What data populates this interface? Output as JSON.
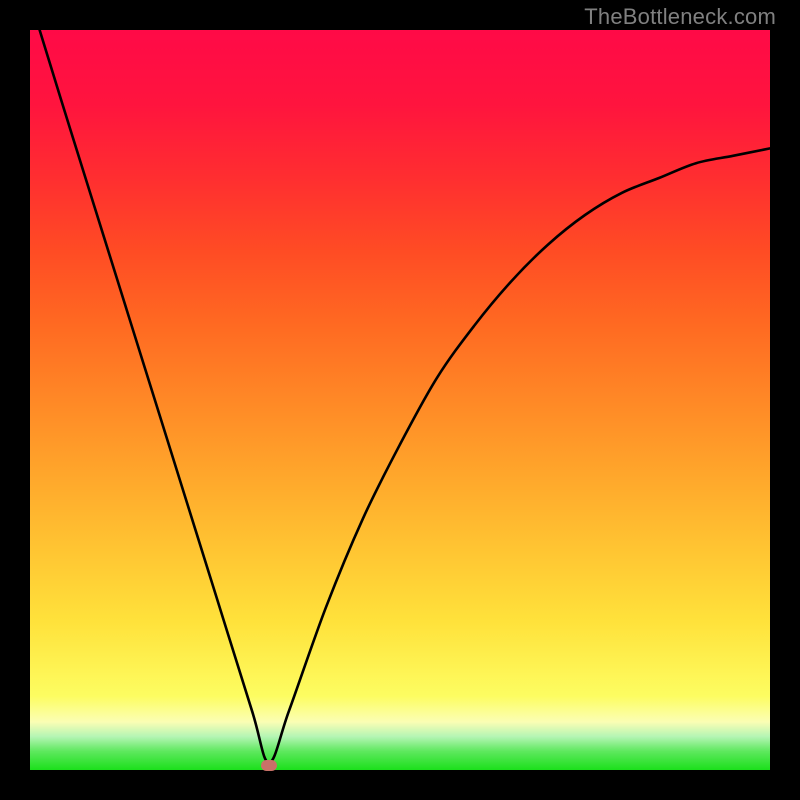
{
  "watermark": "TheBottleneck.com",
  "colors": {
    "watermark": "#808080",
    "marker": "#c97168",
    "curve": "#000000",
    "frame": "#000000"
  },
  "chart_data": {
    "type": "line",
    "title": "",
    "xlabel": "",
    "ylabel": "",
    "xlim": [
      0,
      1
    ],
    "ylim": [
      0,
      1
    ],
    "legend": false,
    "grid": false,
    "series": [
      {
        "name": "bottleneck-curve",
        "x": [
          0.013,
          0.05,
          0.1,
          0.15,
          0.2,
          0.25,
          0.3,
          0.323,
          0.35,
          0.4,
          0.45,
          0.5,
          0.55,
          0.6,
          0.65,
          0.7,
          0.75,
          0.8,
          0.85,
          0.9,
          0.95,
          1.0
        ],
        "values": [
          1.0,
          0.88,
          0.72,
          0.56,
          0.4,
          0.24,
          0.08,
          0.01,
          0.08,
          0.22,
          0.34,
          0.44,
          0.53,
          0.6,
          0.66,
          0.71,
          0.75,
          0.78,
          0.8,
          0.82,
          0.83,
          0.84
        ]
      }
    ],
    "marker": {
      "x": 0.323,
      "y": 0.006
    },
    "annotations": []
  }
}
